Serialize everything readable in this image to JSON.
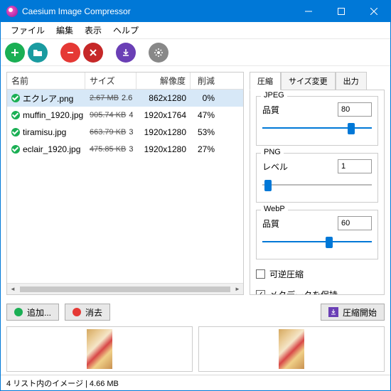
{
  "window": {
    "title": "Caesium Image Compressor"
  },
  "menu": {
    "file": "ファイル",
    "edit": "編集",
    "view": "表示",
    "help": "ヘルプ"
  },
  "columns": {
    "name": "名前",
    "size": "サイズ",
    "resolution": "解像度",
    "reduction": "削減"
  },
  "files": [
    {
      "name": "エクレア.png",
      "old_size": "2.67 MB",
      "new_size": "2.6",
      "resolution": "862x1280",
      "reduction": "0%",
      "selected": true
    },
    {
      "name": "muffin_1920.jpg",
      "old_size": "905.74 KB",
      "new_size": "4",
      "resolution": "1920x1764",
      "reduction": "47%",
      "selected": false
    },
    {
      "name": "tiramisu.jpg",
      "old_size": "663.79 KB",
      "new_size": "3",
      "resolution": "1920x1280",
      "reduction": "53%",
      "selected": false
    },
    {
      "name": "eclair_1920.jpg",
      "old_size": "475.85 KB",
      "new_size": "3",
      "resolution": "1920x1280",
      "reduction": "27%",
      "selected": false
    }
  ],
  "tabs": {
    "compress": "圧縮",
    "resize": "サイズ変更",
    "output": "出力"
  },
  "jpeg": {
    "title": "JPEG",
    "quality_label": "品質",
    "quality": "80"
  },
  "png": {
    "title": "PNG",
    "level_label": "レベル",
    "level": "1"
  },
  "webp": {
    "title": "WebP",
    "quality_label": "品質",
    "quality": "60"
  },
  "options": {
    "lossless": "可逆圧縮",
    "keep_metadata": "メタデータを保持",
    "lossless_checked": false,
    "metadata_checked": true
  },
  "actions": {
    "add": "追加...",
    "clear": "消去",
    "compress": "圧縮開始"
  },
  "status": "4 リスト内のイメージ | 4.66 MB"
}
